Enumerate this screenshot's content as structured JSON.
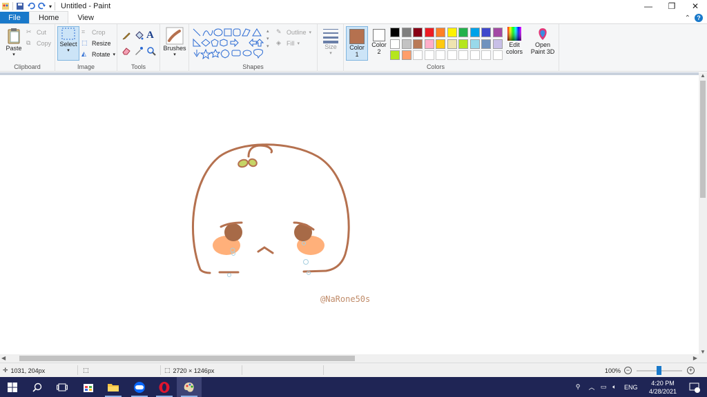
{
  "window": {
    "title": "Untitled - Paint",
    "minimize_icon": "minimize-icon",
    "maximize_icon": "restore-icon",
    "close_icon": "close-icon"
  },
  "tabs": [
    {
      "label": "File"
    },
    {
      "label": "Home"
    },
    {
      "label": "View"
    }
  ],
  "ribbon": {
    "clipboard": {
      "label": "Clipboard",
      "paste": "Paste",
      "cut": "Cut",
      "copy": "Copy"
    },
    "image": {
      "label": "Image",
      "select": "Select",
      "crop": "Crop",
      "resize": "Resize",
      "rotate": "Rotate"
    },
    "tools": {
      "label": "Tools"
    },
    "brushes": {
      "label": "Brushes"
    },
    "shapes": {
      "label": "Shapes",
      "outline": "Outline",
      "fill": "Fill"
    },
    "size": {
      "label": "Size"
    },
    "colors": {
      "label": "Colors",
      "color1_label": "Color 1",
      "color1_value": "#b5714f",
      "color2_label": "Color 2",
      "color2_value": "#ffffff",
      "edit_colors": "Edit colors",
      "row1": [
        "#000000",
        "#7f7f7f",
        "#880015",
        "#ed1c24",
        "#ff7f27",
        "#fff200",
        "#22b14c",
        "#00a2e8",
        "#3f48cc",
        "#a349a4"
      ],
      "row2": [
        "#ffffff",
        "#c3c3c3",
        "#b97a57",
        "#ffaec9",
        "#ffc90e",
        "#efe4b0",
        "#b5e61d",
        "#99d9ea",
        "#7092be",
        "#c8bfe7"
      ],
      "row3": [
        "#b5e61d",
        "#ff9e6b"
      ]
    },
    "paint3d": "Open Paint 3D"
  },
  "canvas": {
    "watermark": "@NaRone50s",
    "stroke_color": "#b5714f",
    "cheek_color": "#ffb07a",
    "eye_color": "#a76a47",
    "leaf_color": "#c6d466",
    "tear_color": "#a6cfe0"
  },
  "status": {
    "cursor_pos": "1031, 204px",
    "canvas_size": "2720 × 1246px",
    "zoom": "100%"
  },
  "taskbar": {
    "lang": "ENG",
    "time": "4:20 PM",
    "date": "4/28/2021",
    "notification_count": "1"
  }
}
